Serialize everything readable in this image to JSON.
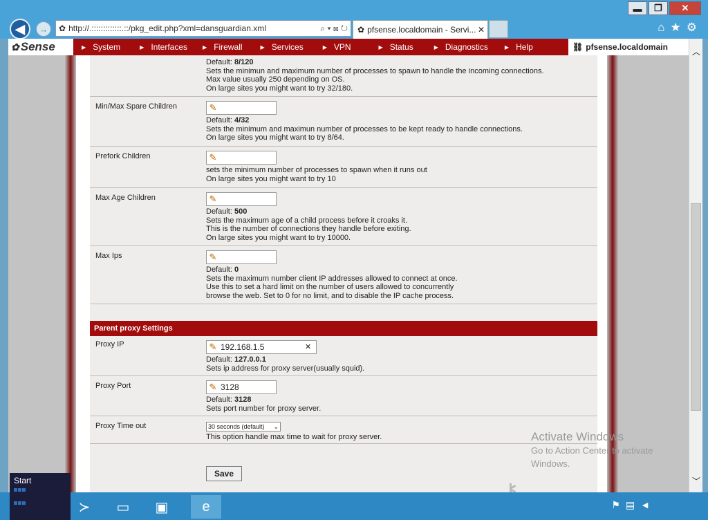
{
  "browser": {
    "url": "http://.:::::::::::::.::/pkg_edit.php?xml=dansguardian.xml",
    "tab_title": "pfsense.localdomain - Servi...",
    "tab_close": "✕",
    "address_tools": "⌕ ▾ ⊠ ↻"
  },
  "window_controls": {
    "minimize": "▬",
    "restore": "❐",
    "close": "✕"
  },
  "pfsense": {
    "logo_text": "Sense",
    "host": "pfsense.localdomain",
    "menu": [
      {
        "label": "System"
      },
      {
        "label": "Interfaces"
      },
      {
        "label": "Firewall"
      },
      {
        "label": "Services"
      },
      {
        "label": "VPN"
      },
      {
        "label": "Status"
      },
      {
        "label": "Diagnostics"
      },
      {
        "label": "Help"
      }
    ]
  },
  "form": {
    "top_row": {
      "default_prefix": "Default: ",
      "default_value": "8/120",
      "desc1": "Sets the minimun and maximum number of processes to spawn to handle the incoming connections.",
      "desc2": "Max value usually 250 depending on OS.",
      "desc3": "On large sites you might want to try 32/180."
    },
    "min_max_spare": {
      "label": "Min/Max Spare Children",
      "default_prefix": "Default: ",
      "default_value": "4/32",
      "desc1": "Sets the minimum and maximun number of processes to be kept ready to handle connections.",
      "desc2": "On large sites you might want to try 8/64."
    },
    "prefork": {
      "label": "Prefork Children",
      "desc1": "sets the minimum number of processes to spawn when it runs out",
      "desc2": "On large sites you might want to try 10"
    },
    "max_age": {
      "label": "Max Age Children",
      "default_prefix": "Default: ",
      "default_value": "500",
      "desc1": "Sets the maximum age of a child process before it croaks it.",
      "desc2": "This is the number of connections they handle before exiting.",
      "desc3": "On large sites you might want to try 10000."
    },
    "max_ips": {
      "label": "Max Ips",
      "default_prefix": "Default: ",
      "default_value": "0",
      "desc1": "Sets the maximum number client IP addresses allowed to connect at once.",
      "desc2": "Use this to set a hard limit on the number of users allowed to concurrently",
      "desc3": "browse the web. Set to 0 for no limit, and to disable the IP cache process."
    },
    "parent_proxy_header": "Parent proxy Settings",
    "proxy_ip": {
      "label": "Proxy IP",
      "value": "192.168.1.5",
      "clear": "✕",
      "default_prefix": "Default: ",
      "default_value": "127.0.0.1",
      "desc1": "Sets ip address for proxy server(usually squid)."
    },
    "proxy_port": {
      "label": "Proxy Port",
      "value": "3128",
      "default_prefix": "Default: ",
      "default_value": "3128",
      "desc1": "Sets port number for proxy server."
    },
    "proxy_timeout": {
      "label": "Proxy Time out",
      "selected": "30 seconds (default)",
      "desc1": "This option handle max time to wait for proxy server."
    },
    "save_label": "Save"
  },
  "watermark": {
    "title": "Activate Windows",
    "line1": "Go to Action Center to activate",
    "line2": "Windows."
  },
  "taskbar": {
    "start_label": "Start"
  },
  "icons": [
    "back-icon",
    "forward-icon",
    "home-icon",
    "star-icon",
    "gear-icon",
    "pencil-icon",
    "powershell-icon",
    "file-explorer-icon",
    "server-manager-icon",
    "internet-explorer-icon"
  ]
}
